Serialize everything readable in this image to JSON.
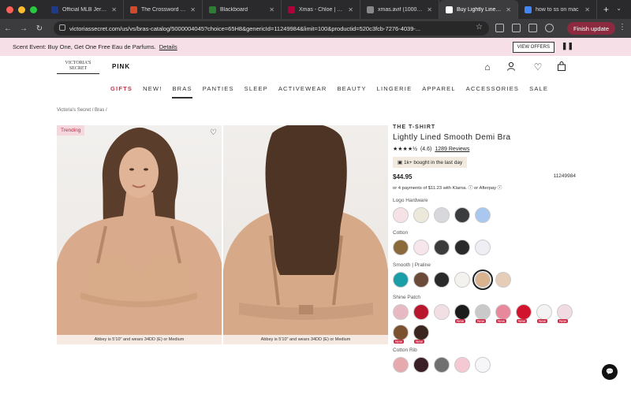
{
  "browser": {
    "tabs": [
      {
        "title": "Official MLB Jersey",
        "color": "#1e3a8a"
      },
      {
        "title": "The Crossword — T",
        "color": "#d14b2b"
      },
      {
        "title": "Blackboard",
        "color": "#2e7d32"
      },
      {
        "title": "Xmas - Chloe | List",
        "color": "#b0003a"
      },
      {
        "title": "xmas.avif (1000×15",
        "color": "#888888"
      },
      {
        "title": "Buy Lightly Lined S",
        "color": "#ffffff"
      },
      {
        "title": "how to ss on mac",
        "color": "#4285f4"
      }
    ],
    "url": "victoriassecret.com/us/vs/bras-catalog/5000004045?choice=65H8&genericId=11249984&limit=100&productid=520c3fcb-7276-4039-...",
    "finish_update_label": "Finish update"
  },
  "promo": {
    "text": "Scent Event: Buy One, Get One Free Eau de Parfums.",
    "details_label": "Details",
    "view_offers_label": "VIEW OFFERS"
  },
  "header": {
    "vs_logo": "VICTORIA'S SECRET",
    "pink_logo": "PINK"
  },
  "nav": [
    "GIFTS",
    "NEW!",
    "BRAS",
    "PANTIES",
    "SLEEP",
    "ACTIVEWEAR",
    "BEAUTY",
    "LINGERIE",
    "APPAREL",
    "ACCESSORIES",
    "SALE"
  ],
  "breadcrumb": "Victoria's Secret / Bras /",
  "gallery": {
    "badge": "Trending",
    "caption1": "Abbey is 5'10\" and wears 34DD (E) or Medium",
    "caption2": "Abbey is 5'10\" and wears 34DD (E) or Medium"
  },
  "product": {
    "brand": "THE T-SHIRT",
    "name": "Lightly Lined Smooth Demi Bra",
    "stars": "★★★★½",
    "rating": "(4.6)",
    "reviews": "1289 Reviews",
    "social_proof": "1k+ bought in the last day",
    "price": "$44.95",
    "sku": "11249984",
    "installments": "or 4 payments of $11.23 with Klarna. ⓘ or Afterpay ⓘ"
  },
  "swatch_groups": [
    {
      "label": "Logo Hardware",
      "colors": [
        "#f6e1e6",
        "#ece8da",
        "#d7d8dc",
        "#3a3c3d",
        "#a9c7ef"
      ],
      "new": [
        false,
        false,
        false,
        false,
        false
      ]
    },
    {
      "label": "Cotton",
      "colors": [
        "#8a6a3b",
        "#f6e6ec",
        "#3b3b3b",
        "#2a2a2a",
        "#eeeef4"
      ],
      "new": [
        false,
        false,
        false,
        false,
        false
      ]
    },
    {
      "label": "Smooth | Praline",
      "colors": [
        "#1a9ea8",
        "#6b4a3a",
        "#2a2a2a",
        "#f4f2ee",
        "#d9b38e",
        "#e6cdb7"
      ],
      "new": [
        false,
        false,
        false,
        false,
        false,
        false
      ],
      "selected": 4
    },
    {
      "label": "Shine Patch",
      "colors": [
        "#e7b9c3",
        "#b8172e",
        "#f2dfe4",
        "#1c1c1c",
        "#c9c9c9",
        "#e8889c",
        "#d2132e",
        "#f3f3f3",
        "#f0dbe2",
        "#7a5230",
        "#3a2520"
      ],
      "new": [
        false,
        false,
        false,
        true,
        true,
        true,
        true,
        true,
        true,
        true,
        true
      ]
    },
    {
      "label": "Cotton Rib",
      "colors": [
        "#e6a9ae",
        "#3a1f27",
        "#707070",
        "#f4c9d3",
        "#f6f6f8"
      ],
      "new": [
        false,
        false,
        false,
        false,
        false
      ]
    }
  ]
}
